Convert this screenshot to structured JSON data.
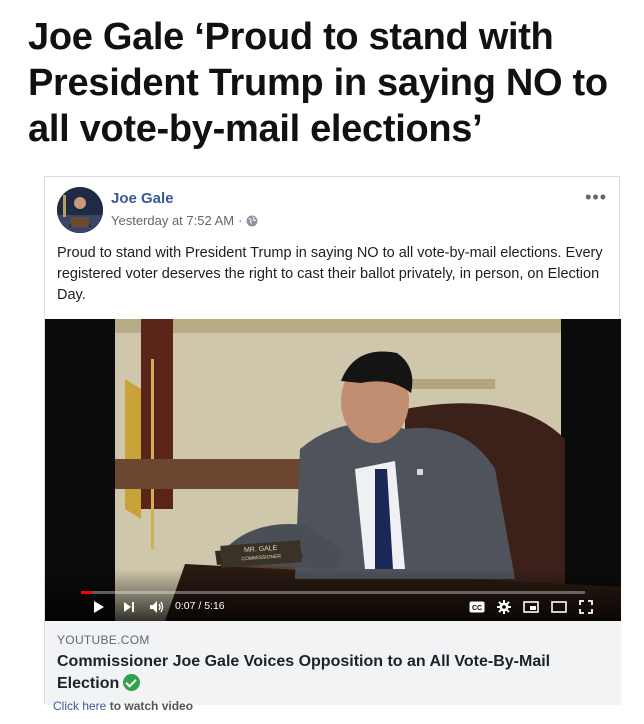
{
  "headline": "Joe Gale ‘Proud to stand with President Trump in saying NO to all vote-by-mail elections’",
  "post": {
    "author": "Joe Gale",
    "timestamp": "Yesterday at 7:52 AM",
    "separator": "·",
    "privacy_icon": "globe-icon",
    "more_label": "•••",
    "text": "Proud to stand with President Trump in saying NO to all vote-by-mail elections. Every registered voter deserves the right to cast their ballot privately, in person, on Election Day."
  },
  "video": {
    "nameplate_line1": "MR. GALE",
    "nameplate_line2": "COMMISSIONER",
    "time": "0:07 / 5:16",
    "progress": 0.022,
    "cc_label": "CC",
    "icons": [
      "play-icon",
      "next-icon",
      "volume-icon",
      "cc-icon",
      "settings-icon",
      "miniplayer-icon",
      "theater-icon",
      "fullscreen-icon"
    ]
  },
  "link": {
    "domain": "YOUTUBE.COM",
    "title": "Commissioner Joe Gale Voices Opposition to an All Vote-By-Mail Election",
    "verified_icon": "verified-check-icon"
  },
  "caption": {
    "link_text": "Click here",
    "rest_text": " to watch video"
  },
  "colors": {
    "author": "#385898",
    "progress": "#ff0000",
    "verified": "#31a24c"
  }
}
